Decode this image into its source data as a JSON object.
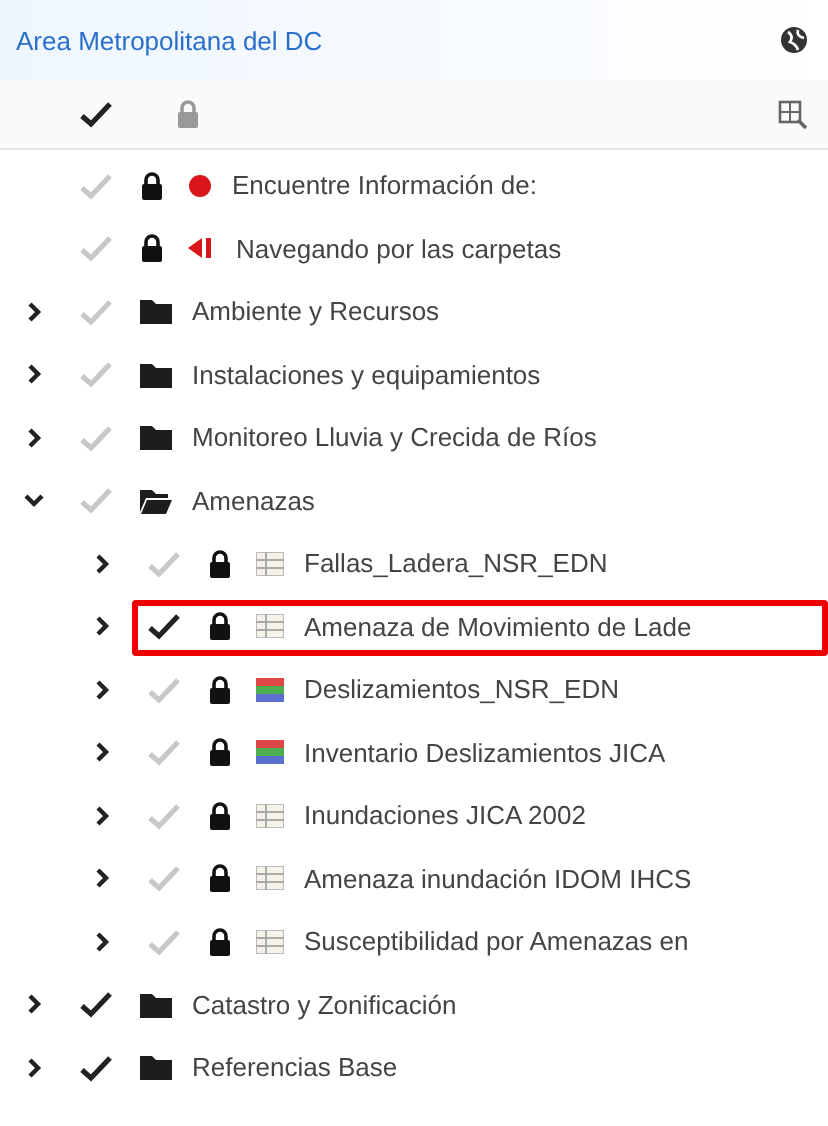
{
  "header": {
    "title": "Area Metropolitana del DC"
  },
  "toolbar": {
    "all_checked": true,
    "locked": false
  },
  "tree": [
    {
      "label": "Encuentre Información de:",
      "kind": "dot",
      "checked": false,
      "locked": true
    },
    {
      "label": "Navegando por las carpetas",
      "kind": "flag",
      "checked": false,
      "locked": true
    },
    {
      "label": "Ambiente y Recursos",
      "kind": "folder",
      "checked": false,
      "expanded": false
    },
    {
      "label": "Instalaciones y equipamientos",
      "kind": "folder",
      "checked": false,
      "expanded": false
    },
    {
      "label": "Monitoreo Lluvia y Crecida de Ríos",
      "kind": "folder",
      "checked": false,
      "expanded": false
    },
    {
      "label": "Amenazas",
      "kind": "folder",
      "checked": false,
      "expanded": true,
      "children": [
        {
          "label": "Fallas_Ladera_NSR_EDN",
          "kind": "layer",
          "checked": false,
          "locked": true,
          "expanded": false,
          "highlighted": false
        },
        {
          "label": "Amenaza de Movimiento de Lade",
          "kind": "layer",
          "checked": true,
          "locked": true,
          "expanded": false,
          "highlighted": true
        },
        {
          "label": "Deslizamientos_NSR_EDN",
          "kind": "ramp",
          "checked": false,
          "locked": true,
          "expanded": false,
          "highlighted": false
        },
        {
          "label": "Inventario Deslizamientos JICA",
          "kind": "ramp",
          "checked": false,
          "locked": true,
          "expanded": false,
          "highlighted": false
        },
        {
          "label": "Inundaciones JICA 2002",
          "kind": "layer",
          "checked": false,
          "locked": true,
          "expanded": false,
          "highlighted": false
        },
        {
          "label": "Amenaza inundación IDOM IHCS",
          "kind": "layer",
          "checked": false,
          "locked": true,
          "expanded": false,
          "highlighted": false
        },
        {
          "label": "Susceptibilidad por Amenazas en",
          "kind": "layer",
          "checked": false,
          "locked": true,
          "expanded": false,
          "highlighted": false
        }
      ]
    },
    {
      "label": "Catastro y Zonificación",
      "kind": "folder",
      "checked": true,
      "expanded": false
    },
    {
      "label": "Referencias Base",
      "kind": "folder",
      "checked": true,
      "expanded": false
    }
  ]
}
